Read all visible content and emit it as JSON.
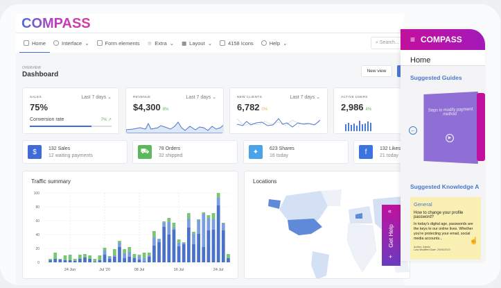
{
  "brand": {
    "logo": "COMPASS"
  },
  "nav": {
    "items": [
      {
        "label": "Home",
        "icon": "home-icon"
      },
      {
        "label": "Interface",
        "icon": "palette-icon"
      },
      {
        "label": "Form elements",
        "icon": "edit-icon"
      },
      {
        "label": "Extra",
        "icon": "star-icon"
      },
      {
        "label": "Layout",
        "icon": "grid-icon"
      },
      {
        "label": "4158 Icons",
        "icon": "box-icon"
      },
      {
        "label": "Help",
        "icon": "help-icon"
      }
    ],
    "search_placeholder": "Search..."
  },
  "page": {
    "overline": "OVERVIEW",
    "title": "Dashboard",
    "new_view": "New view"
  },
  "stats": [
    {
      "label": "SALES",
      "range": "Last 7 days",
      "value": "75%",
      "sub_label": "Conversion rate",
      "sub_change": "7%",
      "progress": 0.75
    },
    {
      "label": "REVENUE",
      "range": "Last 7 days",
      "value": "$4,300",
      "change": "8%"
    },
    {
      "label": "NEW CLIENTS",
      "range": "Last 7 days",
      "value": "6,782",
      "change": "0%"
    },
    {
      "label": "ACTIVE USERS",
      "value": "2,986",
      "change": "4%"
    }
  ],
  "summary": [
    {
      "title": "132 Sales",
      "sub": "12 waiting payments",
      "icon": "dollar-icon",
      "color": "#3f6ad8"
    },
    {
      "title": "78 Orders",
      "sub": "32 shipped",
      "icon": "cart-icon",
      "color": "#5cb85c"
    },
    {
      "title": "623 Shares",
      "sub": "16 today",
      "icon": "twitter-icon",
      "color": "#4aa3e8"
    },
    {
      "title": "132 Likes",
      "sub": "21 today",
      "icon": "facebook-icon",
      "color": "#3b73e0"
    }
  ],
  "traffic": {
    "title": "Traffic summary"
  },
  "locations": {
    "title": "Locations"
  },
  "chart_data": {
    "type": "bar",
    "stacked": true,
    "title": "Traffic summary",
    "x_tick_labels": [
      "24 Jun",
      "Jul '20",
      "08 Jul",
      "16 Jul",
      "24 Jul"
    ],
    "y_ticks": [
      0,
      20,
      40,
      60,
      80,
      100
    ],
    "ylim": [
      0,
      100
    ],
    "grid": true,
    "colors": [
      "#4a72c8",
      "#7a9ee0",
      "#7cc576"
    ],
    "series": [
      {
        "values": [
          3,
          5,
          4,
          3,
          3,
          2,
          5,
          7,
          5,
          1,
          3,
          11,
          5,
          8,
          22,
          6,
          8,
          6,
          4,
          1,
          8,
          24,
          29,
          51,
          40,
          47,
          23,
          26,
          50,
          26,
          41,
          22,
          46,
          47,
          82,
          46,
          6
        ]
      },
      {
        "values": [
          0,
          0,
          0,
          0,
          0,
          0,
          0,
          0,
          0,
          0,
          0,
          6,
          3,
          2,
          6,
          7,
          7,
          1,
          5,
          5,
          2,
          12,
          4,
          6,
          18,
          3,
          5,
          2,
          13,
          15,
          20,
          48,
          18,
          15,
          11,
          10,
          0
        ]
      },
      {
        "values": [
          2,
          9,
          1,
          7,
          8,
          3,
          6,
          5,
          5,
          4,
          7,
          4,
          1,
          9,
          3,
          6,
          7,
          5,
          2,
          8,
          4,
          9,
          1,
          2,
          6,
          7,
          5,
          1,
          8,
          3,
          1,
          2,
          4,
          9,
          7,
          1,
          6
        ]
      }
    ]
  },
  "panel": {
    "logo": "COMPASS",
    "home": "Home",
    "guides_title": "Suggested Guides",
    "guide_text": "Steps to modify payment method",
    "kb_title": "Suggested Knowledge A",
    "kb": {
      "category": "General",
      "question": "How to change your profile password?",
      "body": "In today's digital age, passwords are the keys to our online lives. Whether you're protecting your email, social media accounts...",
      "author": "Author: Admin",
      "modified": "Last Modified Date: 20/09/2023"
    }
  },
  "get_help": "Get Help"
}
